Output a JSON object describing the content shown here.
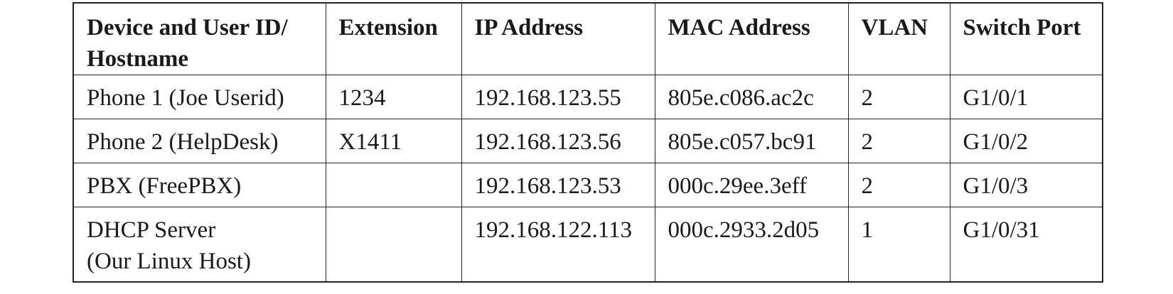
{
  "table": {
    "headers": [
      [
        "Device and User ID/",
        "Hostname"
      ],
      [
        "Extension"
      ],
      [
        "IP Address"
      ],
      [
        "MAC Address"
      ],
      [
        "VLAN"
      ],
      [
        "Switch Port"
      ]
    ],
    "rows": [
      {
        "device": [
          "Phone 1 (Joe Userid)"
        ],
        "extension": "1234",
        "ip": "192.168.123.55",
        "mac": "805e.c086.ac2c",
        "vlan": "2",
        "port": "G1/0/1"
      },
      {
        "device": [
          "Phone 2 (HelpDesk)"
        ],
        "extension": "X1411",
        "ip": "192.168.123.56",
        "mac": "805e.c057.bc91",
        "vlan": "2",
        "port": "G1/0/2"
      },
      {
        "device": [
          "PBX (FreePBX)"
        ],
        "extension": "",
        "ip": "192.168.123.53",
        "mac": "000c.29ee.3eff",
        "vlan": "2",
        "port": "G1/0/3"
      },
      {
        "device": [
          "DHCP Server",
          "(Our Linux Host)"
        ],
        "extension": "",
        "ip": "192.168.122.113",
        "mac": "000c.2933.2d05",
        "vlan": "1",
        "port": "G1/0/31"
      }
    ]
  }
}
